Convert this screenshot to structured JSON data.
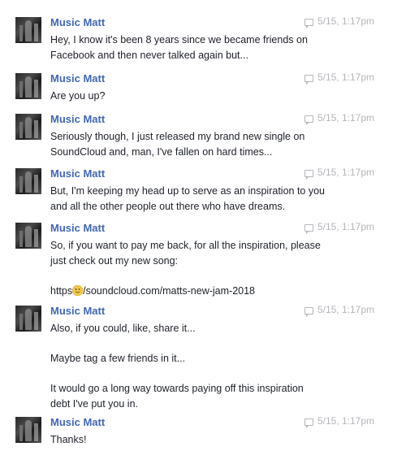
{
  "messages": [
    {
      "sender": "Music Matt",
      "time": "5/15, 1:17pm",
      "lines": [
        "Hey, I know it's been 8 years since we became friends on",
        "Facebook and then never talked again but..."
      ]
    },
    {
      "sender": "Music Matt",
      "time": "5/15, 1:17pm",
      "lines": [
        "Are you up?"
      ]
    },
    {
      "sender": "Music Matt",
      "time": "5/15, 1:17pm",
      "lines": [
        "Seriously though, I just released my brand new single on",
        "SoundCloud and, man, I've fallen on hard times..."
      ]
    },
    {
      "sender": "Music Matt",
      "time": "5/15, 1:17pm",
      "lines": [
        "But, I'm keeping my head up to serve as an inspiration to you",
        "and all the other people out there who have dreams."
      ]
    },
    {
      "sender": "Music Matt",
      "time": "5/15, 1:17pm",
      "lines": [
        "So, if you want to pay me back, for all the inspiration, please",
        "just check out my new song:",
        "",
        "https:/soundcloud.com/matts-new-jam-2018"
      ],
      "link_prefix": "https",
      "link_emoji": "slight-smile-emoji",
      "link_suffix": "/soundcloud.com/matts-new-jam-2018"
    },
    {
      "sender": "Music Matt",
      "time": "5/15, 1:17pm",
      "lines": [
        "Also, if you could, like, share it...",
        "",
        "Maybe tag a few friends in it...",
        "",
        "It would go a long way towards paying off this inspiration",
        "debt I've put you in."
      ]
    },
    {
      "sender": "Music Matt",
      "time": "5/15, 1:17pm",
      "lines": [
        "Thanks!"
      ]
    }
  ],
  "colors": {
    "sender_name": "#4267b2",
    "timestamp": "#b4b6ba",
    "message_text": "#1d2129",
    "background": "#ffffff"
  },
  "icons": {
    "timestamp": "chat-bubble-icon",
    "avatar": "profile-photo"
  }
}
